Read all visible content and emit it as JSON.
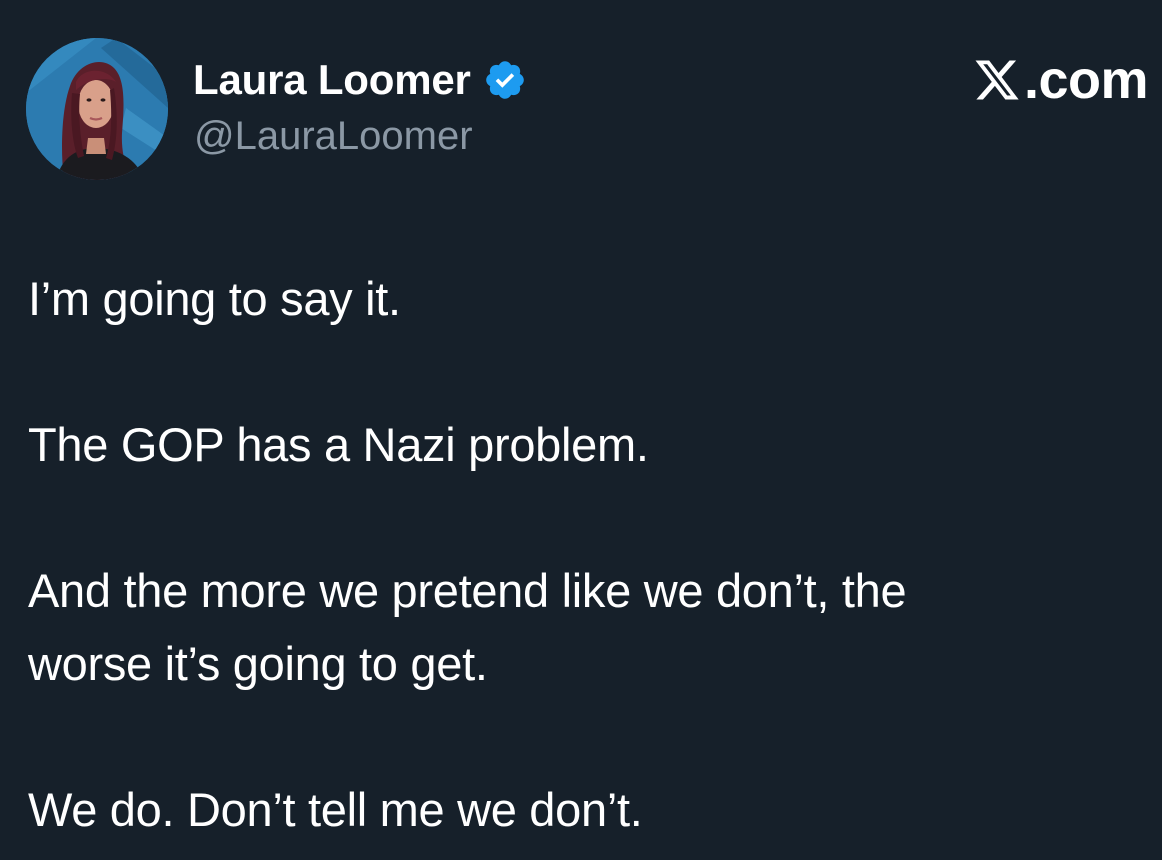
{
  "header": {
    "display_name": "Laura Loomer",
    "handle": "@LauraLoomer",
    "verified_icon": "verified-badge-icon",
    "brand_logo_icon": "x-logo-icon",
    "brand_text": ".com"
  },
  "tweet": {
    "lines": [
      "I’m going to say it.",
      "The GOP has a Nazi problem.",
      "And the more we pretend like we don’t, the",
      "worse it’s going to get.",
      "We do. Don’t tell me we don’t."
    ]
  },
  "colors": {
    "background": "#16202a",
    "text": "#ffffff",
    "handle": "#8b98a5",
    "verified_badge": "#1d9bf0"
  }
}
